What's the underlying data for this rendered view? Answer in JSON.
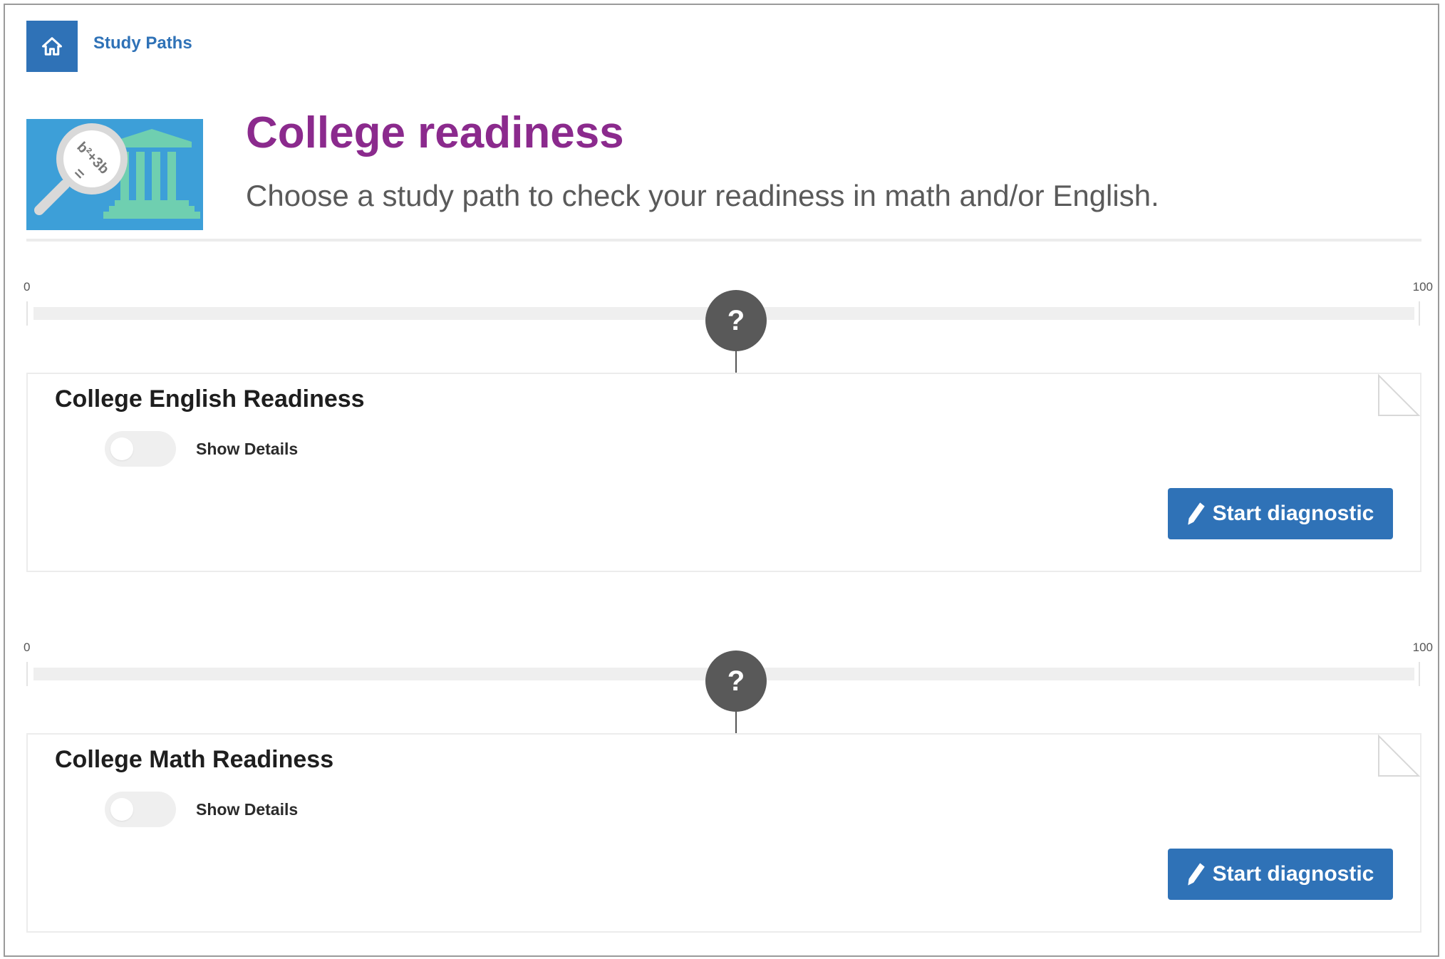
{
  "nav": {
    "home_icon": "home-icon",
    "breadcrumb": "Study Paths"
  },
  "header": {
    "title": "College readiness",
    "subtitle": "Choose a study path to check your readiness in math and/or English.",
    "image_icon": "magnifier-building-illustration",
    "image_text_1": "b²+3b",
    "image_text_2": "="
  },
  "colors": {
    "brand_blue": "#2f72b7",
    "title_purple": "#8b2a8d",
    "marker_gray": "#595959"
  },
  "paths": [
    {
      "scale_min": "0",
      "scale_max": "100",
      "marker": "?",
      "title": "College English Readiness",
      "toggle_label": "Show Details",
      "toggle_on": false,
      "button_label": "Start diagnostic",
      "button_icon": "pencil-icon"
    },
    {
      "scale_min": "0",
      "scale_max": "100",
      "marker": "?",
      "title": "College Math Readiness",
      "toggle_label": "Show Details",
      "toggle_on": false,
      "button_label": "Start diagnostic",
      "button_icon": "pencil-icon"
    }
  ]
}
